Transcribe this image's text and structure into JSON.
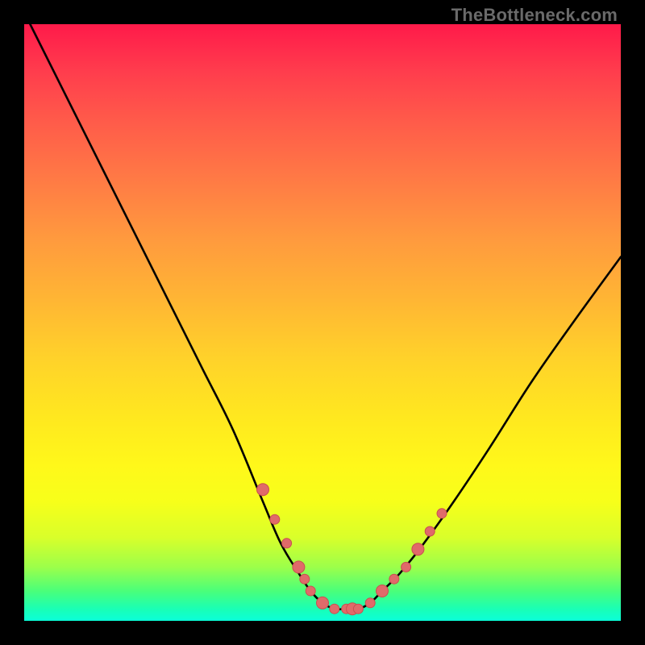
{
  "watermark": "TheBottleneck.com",
  "chart_data": {
    "type": "line",
    "title": "",
    "xlabel": "",
    "ylabel": "",
    "xlim": [
      0,
      100
    ],
    "ylim": [
      0,
      100
    ],
    "grid": false,
    "series": [
      {
        "name": "curve",
        "color": "#000000",
        "x": [
          1,
          5,
          10,
          15,
          20,
          25,
          30,
          35,
          40,
          43,
          46,
          48,
          50,
          52,
          54,
          56,
          58,
          60,
          63,
          67,
          72,
          78,
          85,
          92,
          100
        ],
        "y": [
          100,
          92,
          82,
          72,
          62,
          52,
          42,
          32,
          20,
          13,
          8,
          5,
          3,
          2,
          2,
          2,
          3,
          5,
          8,
          13,
          20,
          29,
          40,
          50,
          61
        ]
      }
    ],
    "markers": {
      "name": "dots",
      "color": "#e06a6a",
      "x": [
        40,
        42,
        44,
        46,
        47,
        48,
        50,
        52,
        54,
        55,
        56,
        58,
        60,
        62,
        64,
        66,
        68,
        70
      ],
      "y": [
        22,
        17,
        13,
        9,
        7,
        5,
        3,
        2,
        2,
        2,
        2,
        3,
        5,
        7,
        9,
        12,
        15,
        18
      ]
    }
  }
}
